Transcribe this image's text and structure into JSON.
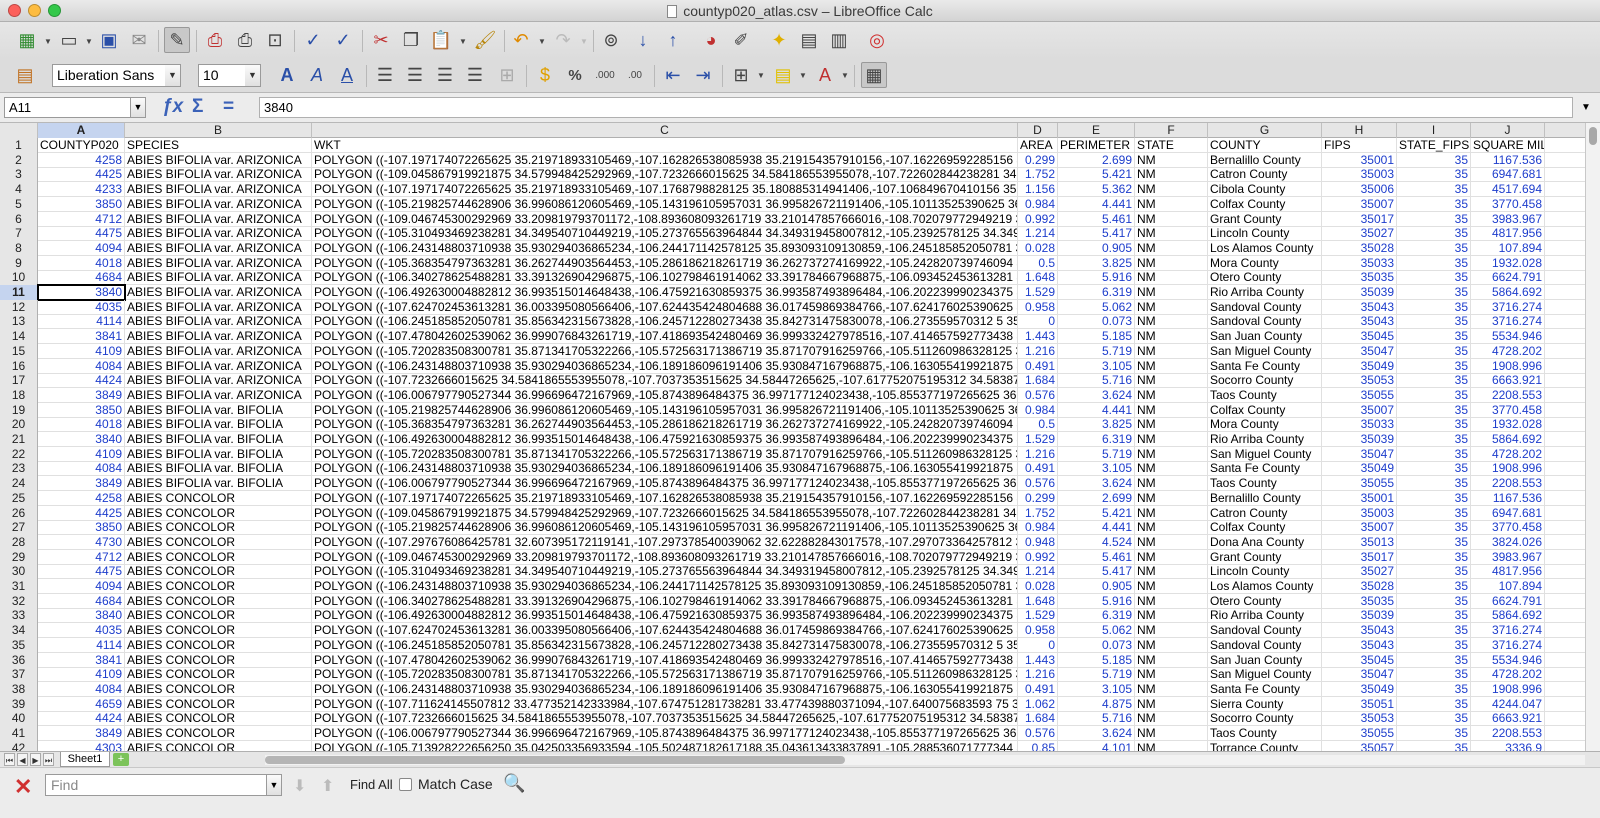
{
  "window": {
    "title": "countyp020_atlas.csv – LibreOffice Calc"
  },
  "toolbar": {
    "font_name": "Liberation Sans",
    "font_size": "10",
    "percent": "%",
    "decimal_add": ".000",
    "decimal_remove": ".00"
  },
  "formula": {
    "cell_ref": "A11",
    "value": "3840"
  },
  "columns": [
    {
      "letter": "A"
    },
    {
      "letter": "B"
    },
    {
      "letter": "C"
    },
    {
      "letter": "D"
    },
    {
      "letter": "E"
    },
    {
      "letter": "F"
    },
    {
      "letter": "G"
    },
    {
      "letter": "H"
    },
    {
      "letter": "I"
    },
    {
      "letter": "J"
    }
  ],
  "header_row": [
    "COUNTYP020",
    "SPECIES",
    "WKT",
    "AREA",
    "PERIMETER",
    "STATE",
    "COUNTY",
    "FIPS",
    "STATE_FIPS",
    "SQUARE MIL"
  ],
  "rows": [
    [
      "4258",
      "ABIES BIFOLIA var. ARIZONICA",
      "POLYGON ((-107.197174072265625 35.219718933105469,-107.162826538085938 35.219154357910156,-107.162269592285156 35",
      "0.299",
      "2.699",
      "NM",
      "Bernalillo County",
      "35001",
      "35",
      "1167.536"
    ],
    [
      "4425",
      "ABIES BIFOLIA var. ARIZONICA",
      "POLYGON ((-109.045867919921875 34.579948425292969,-107.7232666015625 34.584186553955078,-107.722602844238281 34.5",
      "1.752",
      "5.421",
      "NM",
      "Catron County",
      "35003",
      "35",
      "6947.681"
    ],
    [
      "4233",
      "ABIES BIFOLIA var. ARIZONICA",
      "POLYGON ((-107.197174072265625 35.219718933105469,-107.1768798828125 35.180885314941406,-107.106849670410156 35.0",
      "1.156",
      "5.362",
      "NM",
      "Cibola County",
      "35006",
      "35",
      "4517.694"
    ],
    [
      "3850",
      "ABIES BIFOLIA var. ARIZONICA",
      "POLYGON ((-105.219825744628906 36.996086120605469,-105.143196105957031 36.995826721191406,-105.10113525390625 36.9",
      "0.984",
      "4.441",
      "NM",
      "Colfax County",
      "35007",
      "35",
      "3770.458"
    ],
    [
      "4712",
      "ABIES BIFOLIA var. ARIZONICA",
      "POLYGON ((-109.046745300292969 33.209819793701172,-108.893608093261719 33.210147857666016,-108.702079772949219 33",
      "0.992",
      "5.461",
      "NM",
      "Grant County",
      "35017",
      "35",
      "3983.967"
    ],
    [
      "4475",
      "ABIES BIFOLIA var. ARIZONICA",
      "POLYGON ((-105.310493469238281 34.349540710449219,-105.273765563964844 34.349319458007812,-105.2392578125 34.3495",
      "1.214",
      "5.417",
      "NM",
      "Lincoln County",
      "35027",
      "35",
      "4817.956"
    ],
    [
      "4094",
      "ABIES BIFOLIA var. ARIZONICA",
      "POLYGON ((-106.243148803710938 35.930294036865234,-106.244171142578125 35.893093109130859,-106.245185852050781 35",
      "0.028",
      "0.905",
      "NM",
      "Los Alamos County",
      "35028",
      "35",
      "107.894"
    ],
    [
      "4018",
      "ABIES BIFOLIA var. ARIZONICA",
      "POLYGON ((-105.368354797363281 36.262744903564453,-105.286186218261719 36.262737274169922,-105.242820739746094 36",
      "0.5",
      "3.825",
      "NM",
      "Mora County",
      "35033",
      "35",
      "1932.028"
    ],
    [
      "4684",
      "ABIES BIFOLIA var. ARIZONICA",
      "POLYGON ((-106.340278625488281 33.391326904296875,-106.102798461914062 33.391784667968875,-106.093452453613281 33",
      "1.648",
      "5.916",
      "NM",
      "Otero County",
      "35035",
      "35",
      "6624.791"
    ],
    [
      "3840",
      "ABIES BIFOLIA var. ARIZONICA",
      "POLYGON ((-106.492630004882812 36.993515014648438,-106.475921630859375 36.993587493896484,-106.202239990234375 36",
      "1.529",
      "6.319",
      "NM",
      "Rio Arriba County",
      "35039",
      "35",
      "5864.692"
    ],
    [
      "4035",
      "ABIES BIFOLIA var. ARIZONICA",
      "POLYGON ((-107.624702453613281 36.003395080566406,-107.624435424804688 36.017459869384766,-107.624176025390625 36",
      "0.958",
      "5.062",
      "NM",
      "Sandoval County",
      "35043",
      "35",
      "3716.274"
    ],
    [
      "4114",
      "ABIES BIFOLIA var. ARIZONICA",
      "POLYGON ((-106.245185852050781 35.856342315673828,-106.245712280273438 35.842731475830078,-106.273559570312 5 35.8",
      "0",
      "0.073",
      "NM",
      "Sandoval County",
      "35043",
      "35",
      "3716.274"
    ],
    [
      "3841",
      "ABIES BIFOLIA var. ARIZONICA",
      "POLYGON ((-107.478042602539062 36.999076843261719,-107.418693542480469 36.999332427978516,-107.414657592773438 36",
      "1.443",
      "5.185",
      "NM",
      "San Juan County",
      "35045",
      "35",
      "5534.946"
    ],
    [
      "4109",
      "ABIES BIFOLIA var. ARIZONICA",
      "POLYGON ((-105.720283508300781 35.871341705322266,-105.572563171386719 35.871707916259766,-105.511260986328125 35",
      "1.216",
      "5.719",
      "NM",
      "San Miguel County",
      "35047",
      "35",
      "4728.202"
    ],
    [
      "4084",
      "ABIES BIFOLIA var. ARIZONICA",
      "POLYGON ((-106.243148803710938 35.930294036865234,-106.189186096191406 35.930847167968875,-106.163055419921875 35",
      "0.491",
      "3.105",
      "NM",
      "Santa Fe County",
      "35049",
      "35",
      "1908.996"
    ],
    [
      "4424",
      "ABIES BIFOLIA var. ARIZONICA",
      "POLYGON ((-107.7232666015625 34.5841865553955078,-107.7037353515625 34.58447265625,-107.617752075195312 34.5838775",
      "1.684",
      "5.716",
      "NM",
      "Socorro County",
      "35053",
      "35",
      "6663.921"
    ],
    [
      "3849",
      "ABIES BIFOLIA var. ARIZONICA",
      "POLYGON ((-106.006797790527344 36.996696472167969,-105.8743896484375 36.997177124023438,-105.855377197265625 36.9",
      "0.576",
      "3.624",
      "NM",
      "Taos County",
      "35055",
      "35",
      "2208.553"
    ],
    [
      "3850",
      "ABIES BIFOLIA var. BIFOLIA",
      "POLYGON ((-105.219825744628906 36.996086120605469,-105.143196105957031 36.995826721191406,-105.10113525390625 36.9",
      "0.984",
      "4.441",
      "NM",
      "Colfax County",
      "35007",
      "35",
      "3770.458"
    ],
    [
      "4018",
      "ABIES BIFOLIA var. BIFOLIA",
      "POLYGON ((-105.368354797363281 36.262744903564453,-105.286186218261719 36.262737274169922,-105.242820739746094 36",
      "0.5",
      "3.825",
      "NM",
      "Mora County",
      "35033",
      "35",
      "1932.028"
    ],
    [
      "3840",
      "ABIES BIFOLIA var. BIFOLIA",
      "POLYGON ((-106.492630004882812 36.993515014648438,-106.475921630859375 36.993587493896484,-106.202239990234375 36",
      "1.529",
      "6.319",
      "NM",
      "Rio Arriba County",
      "35039",
      "35",
      "5864.692"
    ],
    [
      "4109",
      "ABIES BIFOLIA var. BIFOLIA",
      "POLYGON ((-105.720283508300781 35.871341705322266,-105.572563171386719 35.871707916259766,-105.511260986328125 35",
      "1.216",
      "5.719",
      "NM",
      "San Miguel County",
      "35047",
      "35",
      "4728.202"
    ],
    [
      "4084",
      "ABIES BIFOLIA var. BIFOLIA",
      "POLYGON ((-106.243148803710938 35.930294036865234,-106.189186096191406 35.930847167968875,-106.163055419921875 35",
      "0.491",
      "3.105",
      "NM",
      "Santa Fe County",
      "35049",
      "35",
      "1908.996"
    ],
    [
      "3849",
      "ABIES BIFOLIA var. BIFOLIA",
      "POLYGON ((-106.006797790527344 36.996696472167969,-105.8743896484375 36.997177124023438,-105.855377197265625 36.9",
      "0.576",
      "3.624",
      "NM",
      "Taos County",
      "35055",
      "35",
      "2208.553"
    ],
    [
      "4258",
      "ABIES CONCOLOR",
      "POLYGON ((-107.197174072265625 35.219718933105469,-107.162826538085938 35.219154357910156,-107.162269592285156 35",
      "0.299",
      "2.699",
      "NM",
      "Bernalillo County",
      "35001",
      "35",
      "1167.536"
    ],
    [
      "4425",
      "ABIES CONCOLOR",
      "POLYGON ((-109.045867919921875 34.579948425292969,-107.7232666015625 34.584186553955078,-107.722602844238281 34.5",
      "1.752",
      "5.421",
      "NM",
      "Catron County",
      "35003",
      "35",
      "6947.681"
    ],
    [
      "3850",
      "ABIES CONCOLOR",
      "POLYGON ((-105.219825744628906 36.996086120605469,-105.143196105957031 36.995826721191406,-105.10113525390625 36.9",
      "0.984",
      "4.441",
      "NM",
      "Colfax County",
      "35007",
      "35",
      "3770.458"
    ],
    [
      "4730",
      "ABIES CONCOLOR",
      "POLYGON ((-107.297676086425781 32.607395172119141,-107.297378540039062 32.622882843017578,-107.297073364257812 32",
      "0.948",
      "4.524",
      "NM",
      "Dona Ana County",
      "35013",
      "35",
      "3824.026"
    ],
    [
      "4712",
      "ABIES CONCOLOR",
      "POLYGON ((-109.046745300292969 33.209819793701172,-108.893608093261719 33.210147857666016,-108.702079772949219 33",
      "0.992",
      "5.461",
      "NM",
      "Grant County",
      "35017",
      "35",
      "3983.967"
    ],
    [
      "4475",
      "ABIES CONCOLOR",
      "POLYGON ((-105.310493469238281 34.349540710449219,-105.273765563964844 34.349319458007812,-105.2392578125 34.3495",
      "1.214",
      "5.417",
      "NM",
      "Lincoln County",
      "35027",
      "35",
      "4817.956"
    ],
    [
      "4094",
      "ABIES CONCOLOR",
      "POLYGON ((-106.243148803710938 35.930294036865234,-106.244171142578125 35.893093109130859,-106.245185852050781 35",
      "0.028",
      "0.905",
      "NM",
      "Los Alamos County",
      "35028",
      "35",
      "107.894"
    ],
    [
      "4684",
      "ABIES CONCOLOR",
      "POLYGON ((-106.340278625488281 33.391326904296875,-106.102798461914062 33.391784667968875,-106.093452453613281 33",
      "1.648",
      "5.916",
      "NM",
      "Otero County",
      "35035",
      "35",
      "6624.791"
    ],
    [
      "3840",
      "ABIES CONCOLOR",
      "POLYGON ((-106.492630004882812 36.993515014648438,-106.475921630859375 36.993587493896484,-106.202239990234375 36",
      "1.529",
      "6.319",
      "NM",
      "Rio Arriba County",
      "35039",
      "35",
      "5864.692"
    ],
    [
      "4035",
      "ABIES CONCOLOR",
      "POLYGON ((-107.624702453613281 36.003395080566406,-107.624435424804688 36.017459869384766,-107.624176025390625 36",
      "0.958",
      "5.062",
      "NM",
      "Sandoval County",
      "35043",
      "35",
      "3716.274"
    ],
    [
      "4114",
      "ABIES CONCOLOR",
      "POLYGON ((-106.245185852050781 35.856342315673828,-106.245712280273438 35.842731475830078,-106.273559570312 5 35.8",
      "0",
      "0.073",
      "NM",
      "Sandoval County",
      "35043",
      "35",
      "3716.274"
    ],
    [
      "3841",
      "ABIES CONCOLOR",
      "POLYGON ((-107.478042602539062 36.999076843261719,-107.418693542480469 36.999332427978516,-107.414657592773438 36",
      "1.443",
      "5.185",
      "NM",
      "San Juan County",
      "35045",
      "35",
      "5534.946"
    ],
    [
      "4109",
      "ABIES CONCOLOR",
      "POLYGON ((-105.720283508300781 35.871341705322266,-105.572563171386719 35.871707916259766,-105.511260986328125 35",
      "1.216",
      "5.719",
      "NM",
      "San Miguel County",
      "35047",
      "35",
      "4728.202"
    ],
    [
      "4084",
      "ABIES CONCOLOR",
      "POLYGON ((-106.243148803710938 35.930294036865234,-106.189186096191406 35.930847167968875,-106.163055419921875 35",
      "0.491",
      "3.105",
      "NM",
      "Santa Fe County",
      "35049",
      "35",
      "1908.996"
    ],
    [
      "4659",
      "ABIES CONCOLOR",
      "POLYGON ((-107.711624145507812 33.477352142333984,-107.674751281738281 33.477439880371094,-107.640075683593 75 33.4",
      "1.062",
      "4.875",
      "NM",
      "Sierra County",
      "35051",
      "35",
      "4244.047"
    ],
    [
      "4424",
      "ABIES CONCOLOR",
      "POLYGON ((-107.7232666015625 34.5841865553955078,-107.7037353515625 34.58447265625,-107.617752075195312 34.5838775",
      "1.684",
      "5.716",
      "NM",
      "Socorro County",
      "35053",
      "35",
      "6663.921"
    ],
    [
      "3849",
      "ABIES CONCOLOR",
      "POLYGON ((-106.006797790527344 36.996696472167969,-105.8743896484375 36.997177124023438,-105.855377197265625 36.9",
      "0.576",
      "3.624",
      "NM",
      "Taos County",
      "35055",
      "35",
      "2208.553"
    ],
    [
      "4303",
      "ABIES CONCOLOR",
      "POLYGON ((-105.713928222656250 35.042503356933594,-105.502487182617188 35.043613433837891,-105.288536071777344 35",
      "0.85",
      "4.101",
      "NM",
      "Torrance County",
      "35057",
      "35",
      "3336.9"
    ]
  ],
  "sheet": {
    "tab": "Sheet1"
  },
  "find": {
    "placeholder": "Find",
    "find_all": "Find All",
    "match_case": "Match Case"
  }
}
